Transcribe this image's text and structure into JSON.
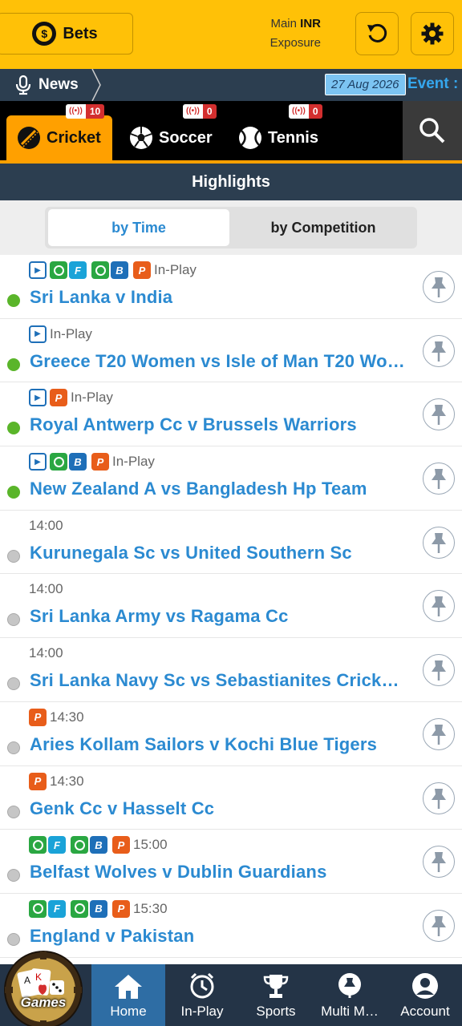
{
  "header": {
    "bets_label": "Bets",
    "main_label": "Main",
    "currency": "INR",
    "exposure_label": "Exposure"
  },
  "news": {
    "label": "News",
    "date": "27 Aug 2026",
    "event_label": "Event :"
  },
  "sports": [
    {
      "label": "Cricket",
      "count": "10",
      "active": true
    },
    {
      "label": "Soccer",
      "count": "0",
      "active": false
    },
    {
      "label": "Tennis",
      "count": "0",
      "active": false
    }
  ],
  "highlights_title": "Highlights",
  "tabs": {
    "by_time": "by Time",
    "by_competition": "by Competition"
  },
  "matches": [
    {
      "name": "Sri Lanka v India",
      "status": "In-Play",
      "live": true,
      "icons": [
        "play",
        "clock-f",
        "clock-b",
        "p"
      ]
    },
    {
      "name": "Greece T20 Women vs Isle of Man T20 Wo…",
      "status": "In-Play",
      "live": true,
      "icons": [
        "play"
      ]
    },
    {
      "name": "Royal Antwerp Cc v Brussels Warriors",
      "status": "In-Play",
      "live": true,
      "icons": [
        "play",
        "p"
      ]
    },
    {
      "name": "New Zealand A vs Bangladesh Hp Team",
      "status": "In-Play",
      "live": true,
      "icons": [
        "play",
        "clock-b",
        "p"
      ]
    },
    {
      "name": "Kurunegala Sc vs United Southern Sc",
      "status": "14:00",
      "live": false,
      "icons": []
    },
    {
      "name": "Sri Lanka Army vs Ragama Cc",
      "status": "14:00",
      "live": false,
      "icons": []
    },
    {
      "name": "Sri Lanka Navy Sc vs Sebastianites Crick…",
      "status": "14:00",
      "live": false,
      "icons": []
    },
    {
      "name": "Aries Kollam Sailors v Kochi Blue Tigers",
      "status": "14:30",
      "live": false,
      "icons": [
        "p"
      ]
    },
    {
      "name": "Genk Cc v Hasselt Cc",
      "status": "14:30",
      "live": false,
      "icons": [
        "p"
      ]
    },
    {
      "name": "Belfast Wolves v Dublin Guardians",
      "status": "15:00",
      "live": false,
      "icons": [
        "clock-f",
        "clock-b",
        "p"
      ]
    },
    {
      "name": "England v Pakistan",
      "status": "15:30",
      "live": false,
      "icons": [
        "clock-f",
        "clock-b",
        "p"
      ]
    }
  ],
  "nav": [
    {
      "label": "Home",
      "icon": "home-icon",
      "active": true
    },
    {
      "label": "In-Play",
      "icon": "clock-icon",
      "active": false
    },
    {
      "label": "Sports",
      "icon": "trophy-icon",
      "active": false
    },
    {
      "label": "Multi M…",
      "icon": "pin-icon",
      "active": false
    },
    {
      "label": "Account",
      "icon": "account-icon",
      "active": false
    }
  ],
  "games_label": "Games",
  "colors": {
    "accent": "#ffc107",
    "link": "#2b8ad1",
    "dark": "#2c3e50",
    "live": "#5ab52a"
  }
}
